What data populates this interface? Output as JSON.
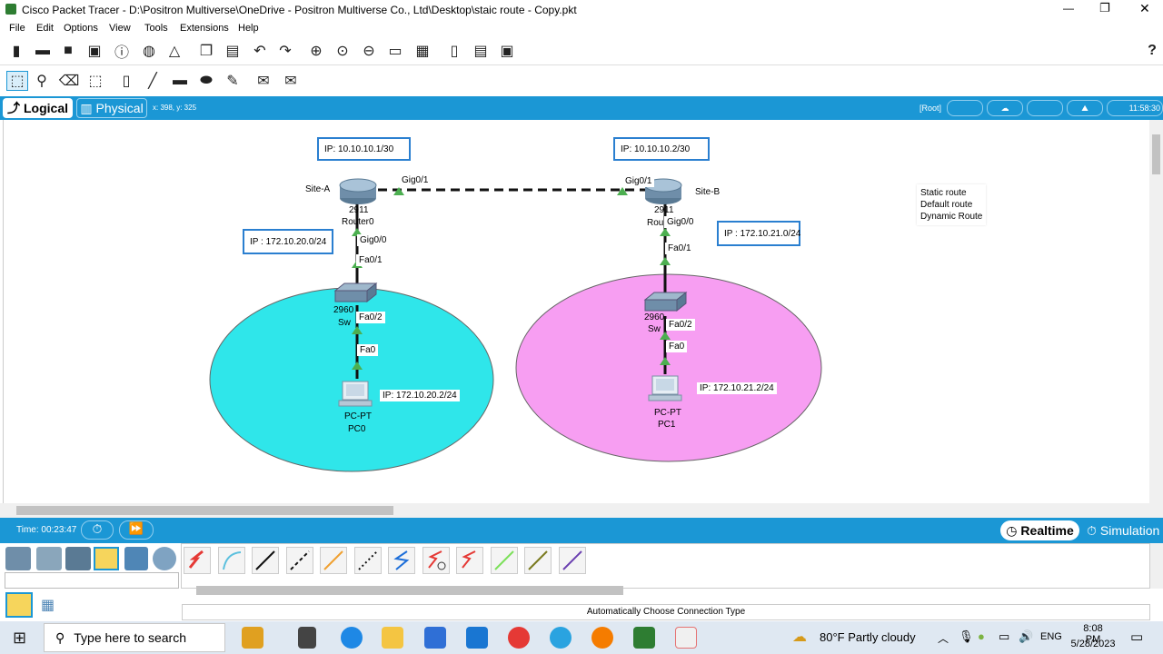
{
  "window": {
    "title": "Cisco Packet Tracer - D:\\Positron Multiverse\\OneDrive - Positron Multiverse Co., Ltd\\Desktop\\staic route - Copy.pkt",
    "controls": [
      "—",
      "❐",
      "✕"
    ]
  },
  "menu": [
    "File",
    "Edit",
    "Options",
    "View",
    "Tools",
    "Extensions",
    "Help"
  ],
  "workspace": {
    "logical_label": "Logical",
    "physical_label": "Physical",
    "coords": "x: 398, y: 325",
    "root_label": "[Root]",
    "clock": "11:58:30"
  },
  "topology": {
    "ip_site_a_wan": "IP: 10.10.10.1/30",
    "ip_site_b_wan": "IP: 10.10.10.2/30",
    "ip_lan_a": "IP : 172.10.20.0/24",
    "ip_lan_b": "IP : 172.10.21.0/24",
    "ip_pc0": "IP: 172.10.20.2/24",
    "ip_pc1": "IP: 172.10.21.2/24",
    "site_a": "Site-A",
    "site_b": "Site-B",
    "router0_model": "2911",
    "router0_name": "Router0",
    "router1_model": "2911",
    "router1_name": "Rou",
    "switch0_model": "2960",
    "switch0_name": "Sw",
    "switch1_model": "2960",
    "switch1_name": "Sw",
    "pc0_type": "PC-PT",
    "pc0_name": "PC0",
    "pc1_type": "PC-PT",
    "pc1_name": "PC1",
    "if_r0_gig01": "Gig0/1",
    "if_r1_gig01": "Gig0/1",
    "if_r0_gig00": "Gig0/0",
    "if_r1_gig00": "Gig0/0",
    "if_sw0_fa01": "Fa0/1",
    "if_sw1_fa01": "Fa0/1",
    "if_sw0_fa02": "Fa0/2",
    "if_sw1_fa02": "Fa0/2",
    "if_pc0_fa0": "Fa0",
    "if_pc1_fa0": "Fa0",
    "notes": [
      "Static route",
      "Default route",
      "Dynamic Route"
    ],
    "lan_a_color": "#2fe6ea",
    "lan_b_color": "#f79ef2"
  },
  "bottom": {
    "time": "Time: 00:23:47",
    "realtime": "Realtime",
    "simulation": "Simulation",
    "connection_status": "Automatically Choose Connection Type"
  },
  "taskbar": {
    "search_placeholder": "Type here to search",
    "weather": "80°F  Partly cloudy",
    "lang": "ENG",
    "time": "8:08 PM",
    "date": "5/28/2023"
  }
}
